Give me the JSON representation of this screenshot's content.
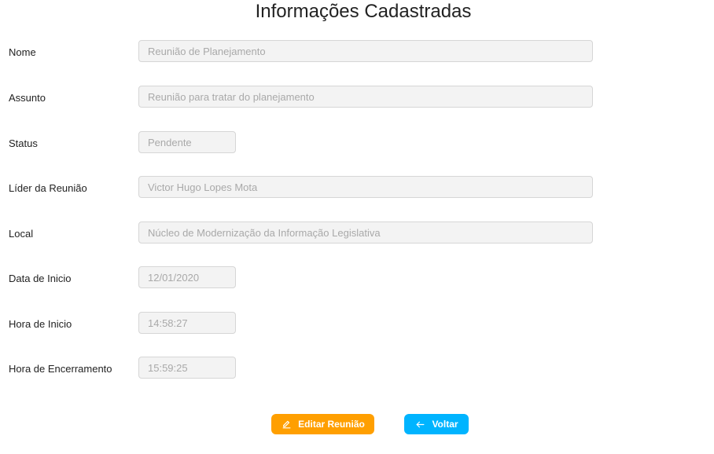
{
  "page": {
    "title": "Informações Cadastradas"
  },
  "form": {
    "nome": {
      "label": "Nome",
      "value": "Reunião de Planejamento"
    },
    "assunto": {
      "label": "Assunto",
      "value": "Reunião para tratar do planejamento"
    },
    "status": {
      "label": "Status",
      "value": "Pendente"
    },
    "lider": {
      "label": "Líder da Reunião",
      "value": "Victor Hugo Lopes Mota"
    },
    "local": {
      "label": "Local",
      "value": "Núcleo de Modernização da Informação Legislativa"
    },
    "data_inicio": {
      "label": "Data de Inicio",
      "value": "12/01/2020"
    },
    "hora_inicio": {
      "label": "Hora de Inicio",
      "value": "14:58:27"
    },
    "hora_encerramento": {
      "label": "Hora de Encerramento",
      "value": "15:59:25"
    }
  },
  "actions": {
    "edit_label": "Editar Reunião",
    "edit_icon": "pencil-icon",
    "back_label": "Voltar",
    "back_icon": "arrow-left-icon"
  },
  "colors": {
    "edit_button": "#ff9f00",
    "back_button": "#00b4ff",
    "input_background": "#f3f3f3",
    "input_text": "#a9a9a9"
  }
}
